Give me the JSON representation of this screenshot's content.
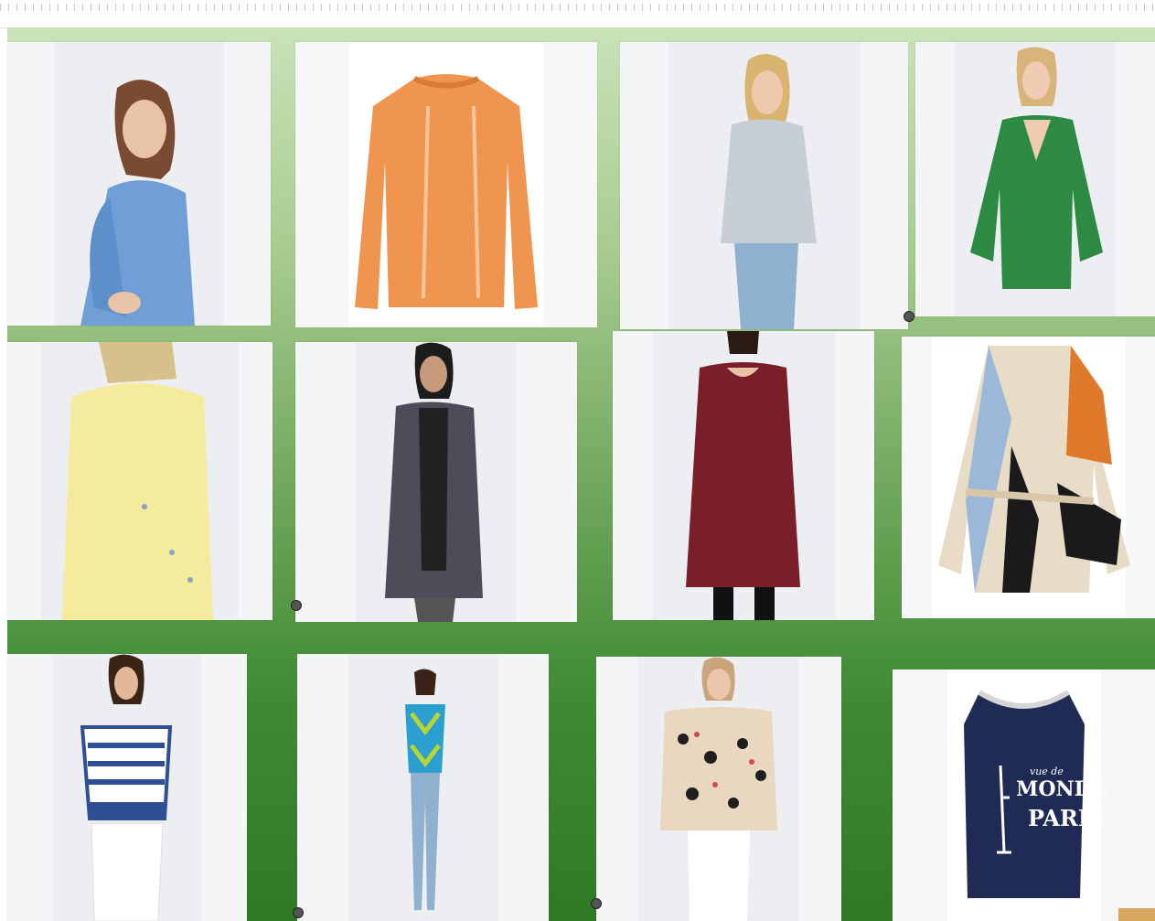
{
  "colors": {
    "board_top": "#c9e2b8",
    "board_bottom": "#2f7a25",
    "tile_bg": "#f4f5f7"
  },
  "products": [
    {
      "id": "p1",
      "garment": "blue puff-sleeve sweater",
      "color": "#6f9fd6",
      "kind": "sweater-model"
    },
    {
      "id": "p2",
      "garment": "orange fringe cable-knit sweater",
      "color": "#f0954f",
      "kind": "sweater-flat"
    },
    {
      "id": "p3",
      "garment": "light grey crewneck sweater",
      "color": "#c8ced6",
      "kind": "sweater-model"
    },
    {
      "id": "p4",
      "garment": "green v-neck sweater",
      "color": "#2c8a43",
      "kind": "sweater-model"
    },
    {
      "id": "p5",
      "garment": "yellow embroidered cardigan",
      "color": "#f4ec9c",
      "kind": "cardigan-model"
    },
    {
      "id": "p6",
      "garment": "charcoal long cardigan",
      "color": "#4d4c59",
      "kind": "cardigan-model"
    },
    {
      "id": "p7",
      "garment": "burgundy sweater dress",
      "color": "#7a1e2a",
      "kind": "dress-model"
    },
    {
      "id": "p8",
      "garment": "patchwork belted cardigan",
      "color": "#e9dcc6",
      "kind": "patchwork-flat"
    },
    {
      "id": "p9",
      "garment": "navy striped knit vest top",
      "color": "#2e4f93",
      "kind": "vest-model"
    },
    {
      "id": "p10",
      "garment": "blue and green argyle sweater vest",
      "color": "#2a9fd0",
      "kind": "vest-model"
    },
    {
      "id": "p11",
      "garment": "leopard print cardigan",
      "color": "#e9d7c0",
      "kind": "cardigan-model"
    },
    {
      "id": "p12",
      "garment": "navy sleeveless knit top",
      "color": "#1f2a55",
      "kind": "tank-flat",
      "print_text": [
        "MONDE",
        "PARIS"
      ],
      "print_small": "vue de"
    }
  ]
}
